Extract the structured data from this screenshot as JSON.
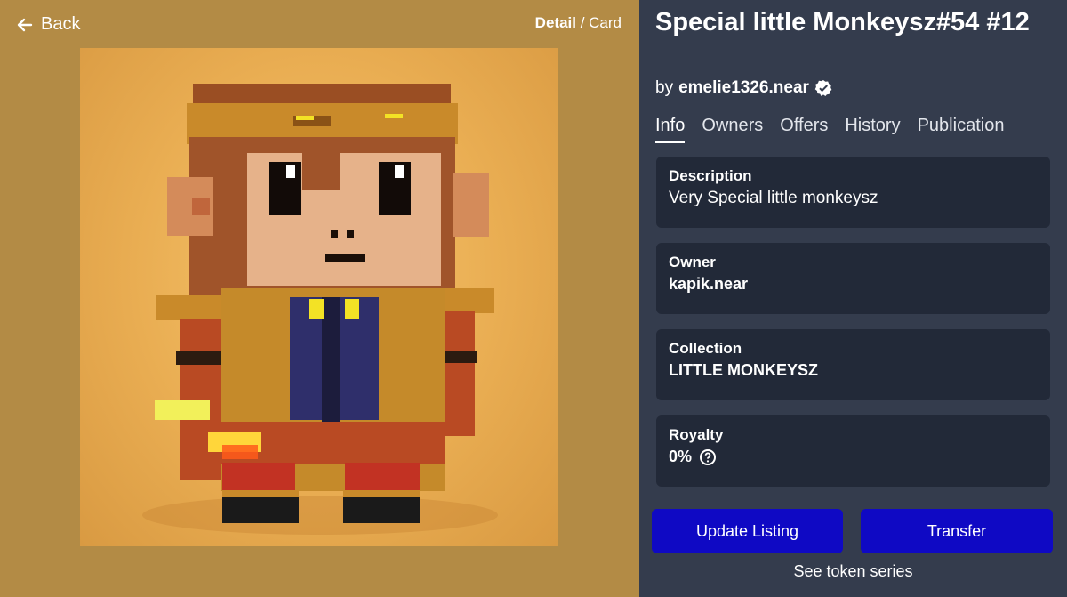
{
  "nav": {
    "back_label": "Back",
    "view_active": "Detail",
    "view_separator": " / ",
    "view_other": "Card"
  },
  "token": {
    "title": "Special little Monkeysz#54 #12",
    "by_prefix": "by",
    "creator": "emelie1326.near"
  },
  "tabs": [
    {
      "label": "Info",
      "active": true
    },
    {
      "label": "Owners",
      "active": false
    },
    {
      "label": "Offers",
      "active": false
    },
    {
      "label": "History",
      "active": false
    },
    {
      "label": "Publication",
      "active": false
    }
  ],
  "info": {
    "description_label": "Description",
    "description_value": "Very Special little monkeysz",
    "owner_label": "Owner",
    "owner_value": "kapik.near",
    "collection_label": "Collection",
    "collection_value": "LITTLE MONKEYSZ",
    "royalty_label": "Royalty",
    "royalty_value": "0%"
  },
  "actions": {
    "update_listing": "Update Listing",
    "transfer": "Transfer",
    "see_token_series": "See token series"
  },
  "icons": {
    "back": "arrow-left-icon",
    "verified": "verified-badge-icon",
    "help": "question-circle-icon"
  },
  "colors": {
    "left_bg": "#b38b45",
    "panel_bg": "#343c4d",
    "card_bg": "#222938",
    "button_bg": "#0f09c4"
  }
}
